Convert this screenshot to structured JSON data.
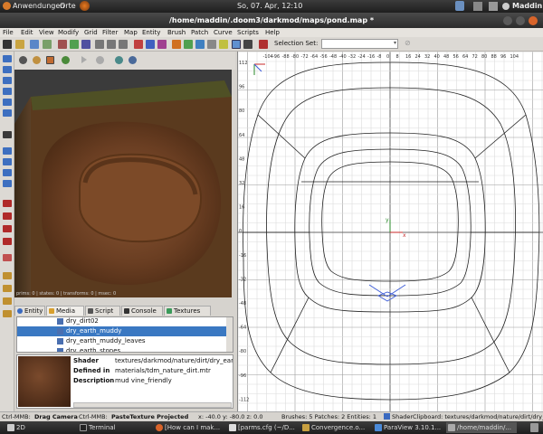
{
  "top_panel": {
    "applications": "Anwendungen",
    "places": "Orte",
    "clock": "So, 07. Apr, 12:10",
    "user": "Maddin"
  },
  "window": {
    "title": "/home/maddin/.doom3/darkmod/maps/pond.map *"
  },
  "menu": [
    "File",
    "Edit",
    "View",
    "Modify",
    "Grid",
    "Filter",
    "Map",
    "Entity",
    "Brush",
    "Patch",
    "Curve",
    "Scripts",
    "Help"
  ],
  "toolbar": {
    "selection_set_label": "Selection Set:",
    "selection_set_value": ""
  },
  "camera": {
    "stats": "prims: 0 | states: 0 | transforms: 0 | msec: 0"
  },
  "tabs": [
    {
      "label": "Entity",
      "active": false
    },
    {
      "label": "Media",
      "active": true
    },
    {
      "label": "Script",
      "active": false
    },
    {
      "label": "Console",
      "active": false
    },
    {
      "label": "Textures",
      "active": false
    }
  ],
  "media_list": [
    "dry_dirt02",
    "dry_earth_muddy",
    "dry_earth_muddy_leaves",
    "dry_earth_stones"
  ],
  "media_selected_index": 1,
  "media_info": {
    "shader_label": "Shader",
    "shader_value": "textures/darkmod/nature/dirt/dry_ear",
    "defined_label": "Defined in",
    "defined_value": "materials/tdm_nature_dirt.mtr",
    "description_label": "Description",
    "description_value": "mud vine_friendly"
  },
  "ortho": {
    "x_ticks": [
      "-104",
      "-96",
      "-88",
      "-80",
      "-72",
      "-64",
      "-56",
      "-48",
      "-40",
      "-32",
      "-24",
      "-16",
      "-8",
      "0",
      "8",
      "16",
      "24",
      "32",
      "40",
      "48",
      "56",
      "64",
      "72",
      "80",
      "88",
      "96",
      "104"
    ],
    "y_ticks": [
      "112",
      "96",
      "80",
      "64",
      "48",
      "32",
      "16",
      "0",
      "-16",
      "-32",
      "-48",
      "-64",
      "-80",
      "-96",
      "-112"
    ],
    "axis_x_label": "x",
    "axis_y_label": "y"
  },
  "status": {
    "mouse_hint_1_key": "Ctrl-MMB:",
    "mouse_hint_1_action": "Drag Camera",
    "mouse_hint_2_key": "Ctrl-MMB:",
    "mouse_hint_2_action": "PasteTexture Projected",
    "coords": "x:   -40.0   y:   -80.0   z:     0.0",
    "counts": "Brushes: 5 Patches: 2 Entities: 1",
    "clipboard": "ShaderClipboard: textures/darkmod/nature/dirt/dry_ea"
  },
  "taskbar": [
    {
      "label": "2D"
    },
    {
      "label": "Terminal"
    },
    {
      "label": "[How can I mak..."
    },
    {
      "label": "[parms.cfg (~/D..."
    },
    {
      "label": "Convergence.o..."
    },
    {
      "label": "ParaView 3.10.1..."
    },
    {
      "label": "/home/maddin/..."
    }
  ],
  "colors": {
    "accent": "#3a78c2",
    "grid_minor": "#e0e0e0",
    "grid_major": "#909090",
    "brush": "#222222",
    "entity_marker": "#3a5ad8"
  }
}
